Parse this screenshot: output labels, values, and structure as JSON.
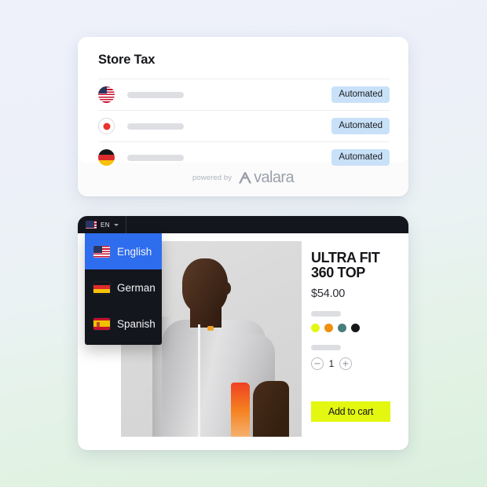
{
  "tax_card": {
    "title": "Store Tax",
    "rows": [
      {
        "flag": "flag-us-icon",
        "country_label": "",
        "status": "Automated"
      },
      {
        "flag": "flag-japan-icon",
        "country_label": "",
        "status": "Automated"
      },
      {
        "flag": "flag-germany-icon",
        "country_label": "",
        "status": "Automated"
      }
    ],
    "footer": {
      "powered_by": "powered by",
      "brand": "valara",
      "brand_full": "Avalara",
      "logo_icon": "avalara-a-logo-icon"
    }
  },
  "store_card": {
    "topbar": {
      "language_code": "EN",
      "flag": "flag-us-icon",
      "chevron": "chevron-down-icon"
    },
    "language_dropdown": {
      "items": [
        {
          "label": "English",
          "flag": "flag-us-icon",
          "selected": true
        },
        {
          "label": "German",
          "flag": "flag-germany-icon",
          "selected": false
        },
        {
          "label": "Spanish",
          "flag": "flag-spain-icon",
          "selected": false
        }
      ],
      "highlight_color": "#2f6def",
      "background_color": "#14161d"
    },
    "product": {
      "image_alt": "athlete wearing grey cycling jersey",
      "title": "ULTRA FIT 360 TOP",
      "price": "$54.00",
      "swatches": [
        {
          "name": "yellow",
          "hex": "#e3f711"
        },
        {
          "name": "orange",
          "hex": "#f0900f"
        },
        {
          "name": "teal",
          "hex": "#4a7c7d"
        },
        {
          "name": "black",
          "hex": "#14161a"
        }
      ],
      "quantity": "1",
      "decrease_icon": "minus-circle-icon",
      "increase_icon": "plus-circle-icon",
      "add_to_cart_label": "Add to cart",
      "add_to_cart_color": "#e3f711"
    }
  },
  "background": {
    "gradient_from": "#eef1fa",
    "gradient_to": "#dcf0de"
  }
}
